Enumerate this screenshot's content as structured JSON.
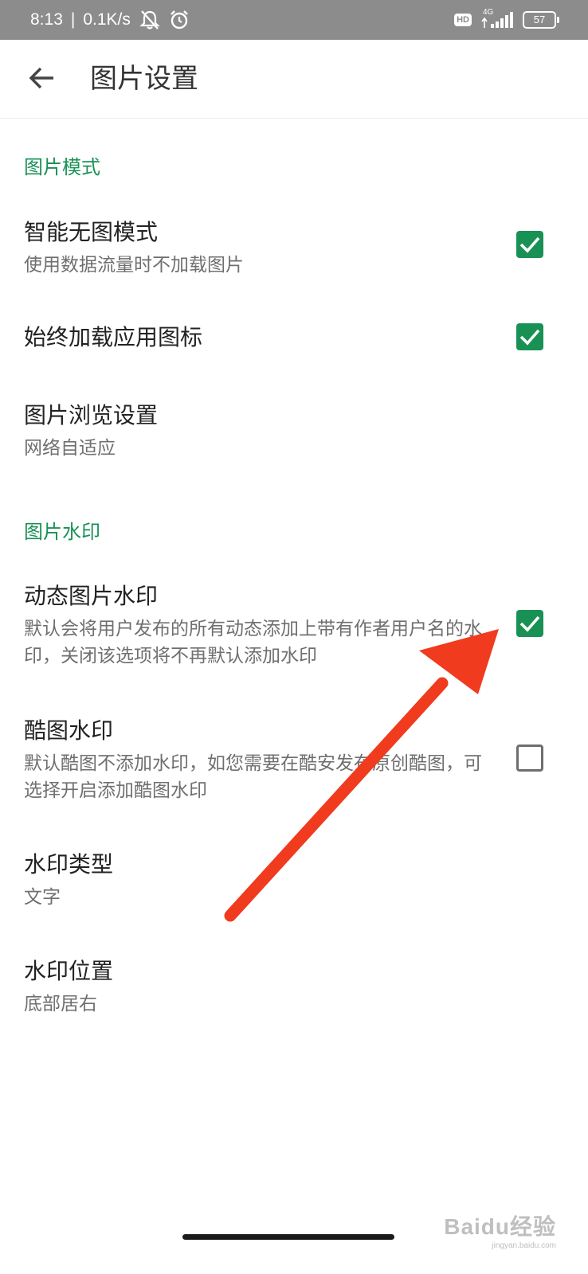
{
  "status_bar": {
    "time": "8:13",
    "separator": "|",
    "net_speed": "0.1K/s",
    "hd_badge": "HD",
    "network_type": "4G",
    "battery": "57"
  },
  "app_bar": {
    "title": "图片设置"
  },
  "sections": {
    "image_mode": {
      "header": "图片模式",
      "items": [
        {
          "title": "智能无图模式",
          "subtitle": "使用数据流量时不加载图片",
          "checked": true
        },
        {
          "title": "始终加载应用图标",
          "checked": true
        },
        {
          "title": "图片浏览设置",
          "subtitle": "网络自适应"
        }
      ]
    },
    "watermark": {
      "header": "图片水印",
      "items": [
        {
          "title": "动态图片水印",
          "subtitle": "默认会将用户发布的所有动态添加上带有作者用户名的水印，关闭该选项将不再默认添加水印",
          "checked": true
        },
        {
          "title": "酷图水印",
          "subtitle": "默认酷图不添加水印，如您需要在酷安发布原创酷图，可选择开启添加酷图水印",
          "checked": false
        },
        {
          "title": "水印类型",
          "subtitle": "文字"
        },
        {
          "title": "水印位置",
          "subtitle": "底部居右"
        }
      ]
    }
  },
  "watermark_overlay": {
    "main": "Baidu经验",
    "sub": "jingyan.baidu.com"
  },
  "colors": {
    "accent": "#199155",
    "annotation_arrow": "#f03b1e",
    "status_bar": "#8c8c8c"
  },
  "icons": [
    "back-arrow-icon",
    "muted-bell-icon",
    "alarm-icon",
    "signal-icon",
    "battery-icon",
    "check-icon"
  ]
}
